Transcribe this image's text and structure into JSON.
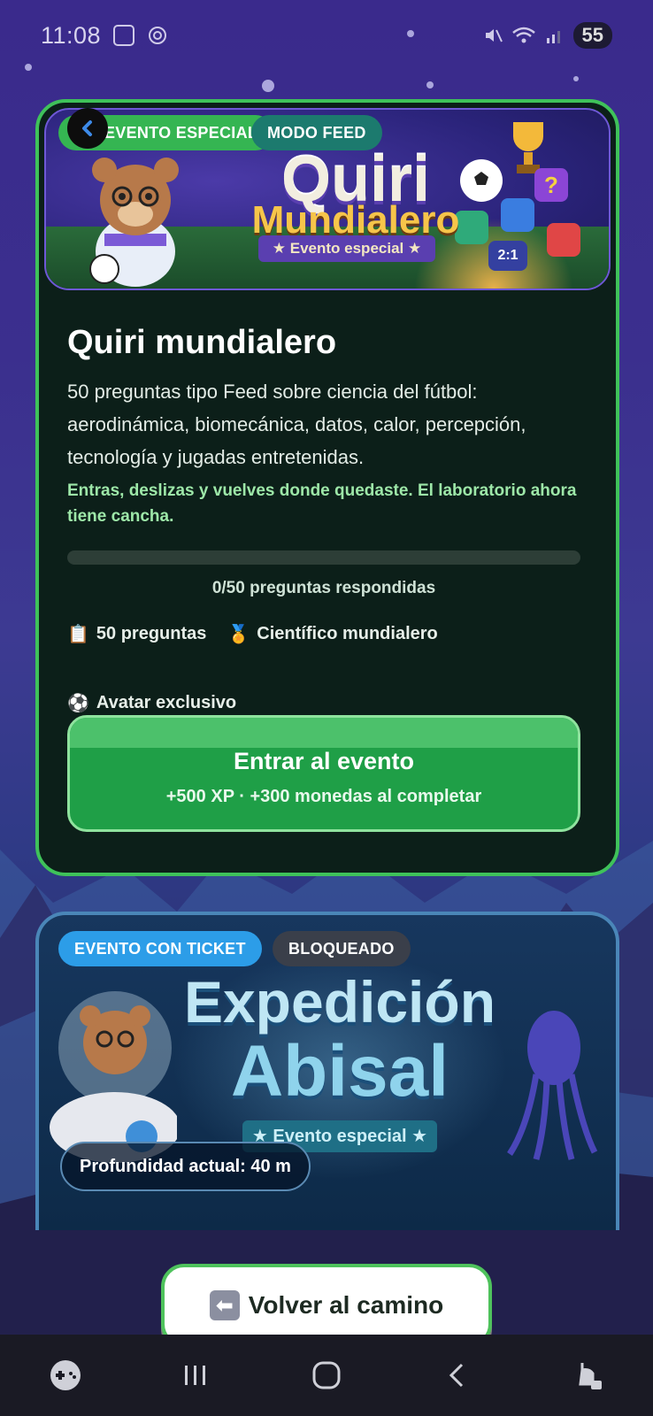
{
  "status_bar": {
    "time": "11:08",
    "battery": "55"
  },
  "event1": {
    "badges": [
      "EVENTO ESPECIAL",
      "MODO FEED"
    ],
    "banner": {
      "title_line1": "Quiri",
      "title_line2": "Mundialero",
      "ribbon": "★ Evento especial ★"
    },
    "title": "Quiri mundialero",
    "description": "50 preguntas tipo Feed sobre ciencia del fútbol: aerodinámica, biomecánica, datos, calor, percepción, tecnología y jugadas entretenidas.",
    "highlight": "Entras, deslizas y vuelves donde quedaste. El laboratorio ahora tiene cancha.",
    "progress": {
      "answered": 0,
      "total": 50,
      "label": "0/50 preguntas respondidas"
    },
    "meta": [
      {
        "icon": "clipboard-icon",
        "glyph": "📋",
        "label": "50 preguntas"
      },
      {
        "icon": "medal-icon",
        "glyph": "🏅",
        "label": "Científico mundialero"
      }
    ],
    "avatar_reward": {
      "icon": "soccer-ball-icon",
      "glyph": "⚽",
      "label": "Avatar exclusivo"
    },
    "button": {
      "label": "Entrar al evento",
      "sublabel": "+500 XP · +300 monedas al completar"
    },
    "accent": "#3fc25a"
  },
  "event2": {
    "badges": [
      "EVENTO CON TICKET",
      "BLOQUEADO"
    ],
    "banner": {
      "title_line1": "Expedición",
      "title_line2": "Abisal",
      "ribbon": "★ Evento especial ★"
    },
    "depth": "Profundidad actual: 40 m",
    "accent": "#4a86b8"
  },
  "back_button": {
    "icon": "arrow-left-icon",
    "label": "Volver al camino"
  },
  "nav": {
    "items": [
      "gamepad-icon",
      "recent-apps-icon",
      "home-icon",
      "back-icon",
      "accessibility-icon"
    ]
  }
}
